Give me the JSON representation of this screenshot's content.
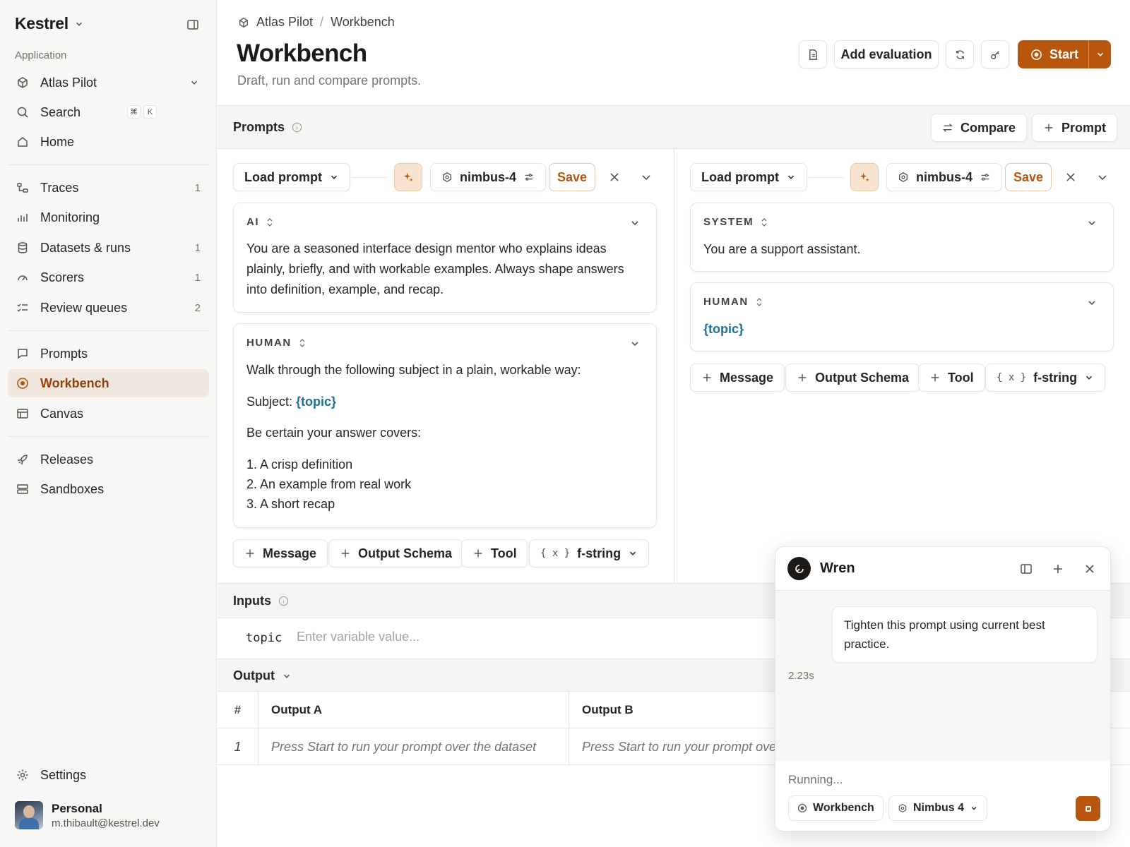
{
  "sidebar": {
    "brand": "Kestrel",
    "section_label": "Application",
    "app_selector": "Atlas Pilot",
    "search_label": "Search",
    "search_shortcut": [
      "⌘",
      "K"
    ],
    "home_label": "Home",
    "items": [
      {
        "label": "Traces",
        "count": "1",
        "icon": "traces-icon"
      },
      {
        "label": "Monitoring",
        "count": "",
        "icon": "bar-chart-icon"
      },
      {
        "label": "Datasets & runs",
        "count": "1",
        "icon": "database-icon"
      },
      {
        "label": "Scorers",
        "count": "1",
        "icon": "gauge-icon"
      },
      {
        "label": "Review queues",
        "count": "2",
        "icon": "checklist-icon"
      }
    ],
    "items2": [
      {
        "label": "Prompts",
        "icon": "message-square-icon"
      },
      {
        "label": "Workbench",
        "icon": "play-circle-icon",
        "active": true
      },
      {
        "label": "Canvas",
        "icon": "canvas-icon"
      }
    ],
    "items3": [
      {
        "label": "Releases",
        "icon": "rocket-icon"
      },
      {
        "label": "Sandboxes",
        "icon": "server-icon"
      }
    ],
    "settings_label": "Settings",
    "user": {
      "name": "Personal",
      "email": "m.thibault@kestrel.dev"
    }
  },
  "header": {
    "breadcrumb": [
      "Atlas Pilot",
      "Workbench"
    ],
    "title": "Workbench",
    "subtitle": "Draft, run and compare prompts.",
    "add_evaluation_label": "Add evaluation",
    "start_label": "Start"
  },
  "prompts_bar": {
    "label": "Prompts",
    "compare_label": "Compare",
    "add_prompt_label": "Prompt"
  },
  "panels": [
    {
      "load_prompt_label": "Load prompt",
      "model": "nimbus-4",
      "save_label": "Save",
      "messages": [
        {
          "role": "AI",
          "text": "You are a seasoned interface design mentor who explains ideas plainly, briefly, and with workable examples. Always shape answers into definition, example, and recap."
        },
        {
          "role": "HUMAN",
          "line1": "Walk through the following subject in a plain, workable way:",
          "subject_prefix": "Subject: ",
          "subject_var": "{topic}",
          "line3": "Be certain your answer covers:",
          "list": [
            "1. A crisp definition",
            "2. An example from real work",
            "3. A short recap"
          ]
        }
      ],
      "actions": {
        "message": "Message",
        "output_schema": "Output Schema",
        "tool": "Tool",
        "format_glyph": "{ x }",
        "format": "f-string"
      }
    },
    {
      "load_prompt_label": "Load prompt",
      "model": "nimbus-4",
      "save_label": "Save",
      "messages": [
        {
          "role": "SYSTEM",
          "text": "You are a support assistant."
        },
        {
          "role": "HUMAN",
          "var": "{topic}"
        }
      ],
      "actions": {
        "message": "Message",
        "output_schema": "Output Schema",
        "tool": "Tool",
        "format_glyph": "{ x }",
        "format": "f-string"
      }
    }
  ],
  "inputs": {
    "label": "Inputs",
    "variable": "topic",
    "placeholder": "Enter variable value..."
  },
  "output": {
    "label": "Output",
    "columns": [
      "#",
      "Output A",
      "Output B"
    ],
    "rows": [
      {
        "index": "1",
        "a": "Press Start to run your prompt over the dataset",
        "b": "Press Start to run your prompt over the dataset"
      }
    ]
  },
  "chat": {
    "title": "Wren",
    "user_message": "Tighten this prompt using current best practice.",
    "elapsed": "2.23s",
    "input_placeholder": "Running...",
    "context_chip": "Workbench",
    "model_chip": "Nimbus 4"
  },
  "colors": {
    "accent": "#b8560e",
    "active_bg": "#f0e8df",
    "variable": "#1f6f98"
  }
}
